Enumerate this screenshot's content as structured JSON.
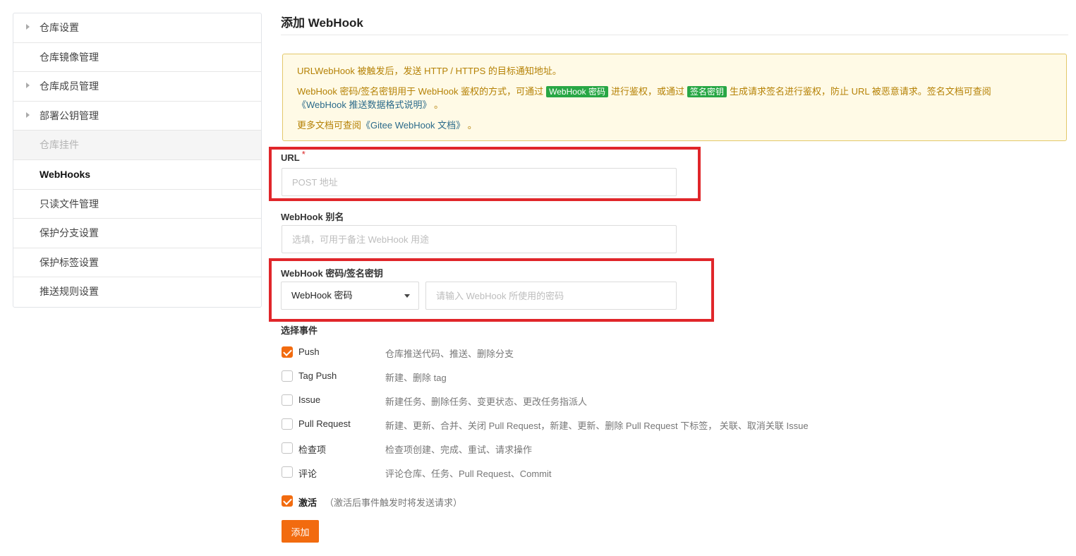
{
  "sidebar": {
    "items": [
      {
        "label": "仓库设置",
        "caret": true,
        "state": "normal"
      },
      {
        "label": "仓库镜像管理",
        "caret": false,
        "state": "normal"
      },
      {
        "label": "仓库成员管理",
        "caret": true,
        "state": "normal"
      },
      {
        "label": "部署公钥管理",
        "caret": true,
        "state": "normal"
      },
      {
        "label": "仓库挂件",
        "caret": false,
        "state": "disabled"
      },
      {
        "label": "WebHooks",
        "caret": false,
        "state": "active"
      },
      {
        "label": "只读文件管理",
        "caret": false,
        "state": "normal"
      },
      {
        "label": "保护分支设置",
        "caret": false,
        "state": "normal"
      },
      {
        "label": "保护标签设置",
        "caret": false,
        "state": "normal"
      },
      {
        "label": "推送规则设置",
        "caret": false,
        "state": "normal"
      }
    ]
  },
  "page": {
    "title": "添加 WebHook"
  },
  "notice": {
    "line1": "URLWebHook 被触发后，发送 HTTP / HTTPS 的目标通知地址。",
    "line2_a": "WebHook 密码/签名密钥用于 WebHook 鉴权的方式，可通过",
    "tag_password": "WebHook 密码",
    "line2_b": "进行鉴权，或通过",
    "tag_sign": "签名密钥",
    "line2_c": "生成请求签名进行鉴权，防止 URL 被恶意请求。签名文档可查阅",
    "link_format": "《WebHook 推送数据格式说明》",
    "line2_end": " 。",
    "line3_a": "更多文档可查阅",
    "link_docs": "《Gitee WebHook 文档》",
    "line3_end": " 。"
  },
  "form": {
    "url_label": "URL",
    "url_required_mark": "*",
    "url_placeholder": "POST 地址",
    "url_value": "",
    "alias_label": "WebHook 别名",
    "alias_placeholder": "选填，可用于备注 WebHook 用途",
    "alias_value": "",
    "secret_label": "WebHook 密码/签名密钥",
    "secret_type_selected": "WebHook 密码",
    "secret_placeholder": "请输入 WebHook 所使用的密码",
    "secret_value": "",
    "events_label": "选择事件",
    "events": [
      {
        "name": "Push",
        "desc": "仓库推送代码、推送、删除分支",
        "checked": true
      },
      {
        "name": "Tag Push",
        "desc": "新建、删除 tag",
        "checked": false
      },
      {
        "name": "Issue",
        "desc": "新建任务、删除任务、变更状态、更改任务指派人",
        "checked": false
      },
      {
        "name": "Pull Request",
        "desc": "新建、更新、合并、关闭 Pull Request，新建、更新、删除 Pull Request 下标签， 关联、取消关联 Issue",
        "checked": false
      },
      {
        "name": "检查项",
        "desc": "检查项创建、完成、重试、请求操作",
        "checked": false
      },
      {
        "name": "评论",
        "desc": "评论仓库、任务、Pull Request、Commit",
        "checked": false
      }
    ],
    "active_label": "激活",
    "active_hint": "（激活后事件触发时将发送请求）",
    "active_checked": true,
    "submit_label": "添加"
  },
  "colors": {
    "accent": "#f26b0f",
    "highlight_box": "#e0262a",
    "notice_bg": "#fffae6",
    "notice_text": "#b58105",
    "tag_green": "#28a745"
  }
}
